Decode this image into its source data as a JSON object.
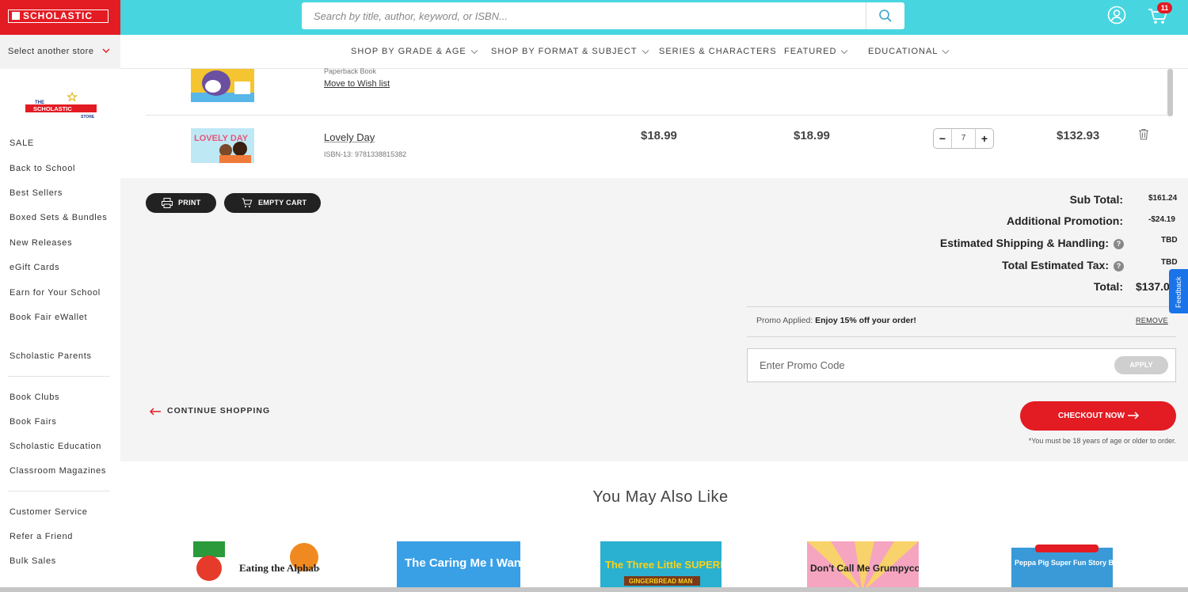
{
  "header": {
    "logo_text": "SCHOLASTIC",
    "search_placeholder": "Search by title, author, keyword, or ISBN...",
    "cart_count": "11",
    "store_select": "Select another store"
  },
  "nav": {
    "items": [
      {
        "label": "SHOP BY GRADE & AGE"
      },
      {
        "label": "SHOP BY FORMAT & SUBJECT"
      },
      {
        "label": "SERIES & CHARACTERS"
      },
      {
        "label": "FEATURED"
      },
      {
        "label": "EDUCATIONAL"
      }
    ]
  },
  "sidebar": {
    "logo_line1": "THE",
    "logo_line2": "SCHOLASTIC",
    "logo_line3": "STORE",
    "items": [
      "SALE",
      "Back to School",
      "Best Sellers",
      "Boxed Sets & Bundles",
      "New Releases",
      "eGift Cards",
      "Earn for Your School",
      "Book Fair eWallet",
      "Scholastic Parents",
      "Book Clubs",
      "Book Fairs",
      "Scholastic Education",
      "Classroom Magazines",
      "Customer Service",
      "Refer a Friend",
      "Bulk Sales"
    ]
  },
  "cart": {
    "row1": {
      "format": "Paperback Book",
      "wish_link": "Move to Wish list"
    },
    "row2": {
      "title": "Lovely Day",
      "isbn": "ISBN-13: 9781338815382",
      "price": "$18.99",
      "our_price": "$18.99",
      "quantity": "7",
      "total": "$132.93",
      "cover_text": "LOVELY DAY"
    }
  },
  "actions": {
    "print": "PRINT",
    "empty_cart": "EMPTY CART"
  },
  "summary": {
    "subtotal_label": "Sub Total:",
    "subtotal": "$161.24",
    "promotion_label": "Additional Promotion:",
    "promotion": "-$24.19",
    "shipping_label": "Estimated Shipping & Handling:",
    "shipping": "TBD",
    "tax_label": "Total Estimated Tax:",
    "tax": "TBD",
    "total_label": "Total:",
    "total": "$137.0"
  },
  "promo": {
    "applied_prefix": "Promo Applied:",
    "applied_text": "Enjoy 15% off your order!",
    "remove": "REMOVE",
    "placeholder": "Enter Promo Code",
    "apply": "APPLY"
  },
  "continue_shopping": "CONTINUE SHOPPING",
  "checkout": "CHECKOUT NOW",
  "age_note": "*You must be 18 years of age or older to order.",
  "feedback": "Feedback",
  "recommendations": {
    "title": "You May Also Like",
    "books": [
      {
        "cover": "Eating the Alphabet"
      },
      {
        "cover": "The Caring Me I Want"
      },
      {
        "cover": "The Three Little SUPERPIGS",
        "subtitle": "GINGERBREAD MAN"
      },
      {
        "cover": "Don't Call Me Grumpycorn"
      },
      {
        "cover": "Peppa Pig Super Fun Story Box"
      }
    ]
  },
  "colors": {
    "brand_red": "#e31b23",
    "header_teal": "#47d6e0",
    "panel_gray": "#f4f4f4"
  }
}
